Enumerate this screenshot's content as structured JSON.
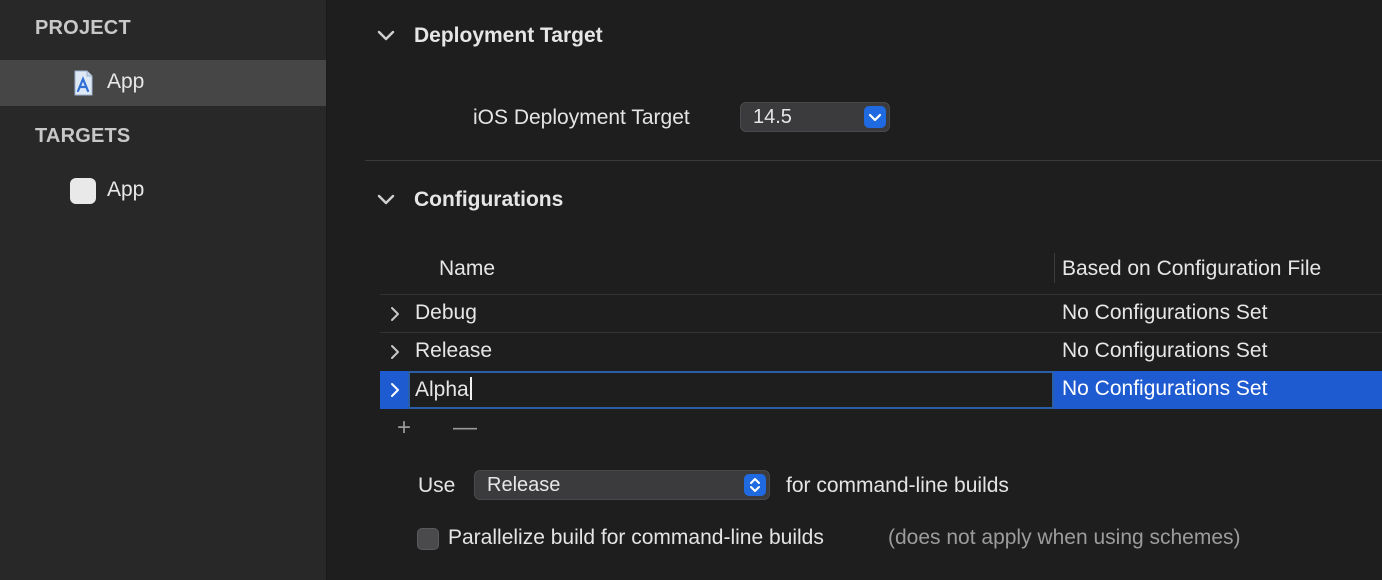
{
  "sidebar": {
    "project_header": "PROJECT",
    "project_items": [
      {
        "label": "App",
        "icon": "project-file-icon"
      }
    ],
    "targets_header": "TARGETS",
    "target_items": [
      {
        "label": "App",
        "icon": "app-target-icon"
      }
    ]
  },
  "deployment": {
    "title": "Deployment Target",
    "ios_label": "iOS Deployment Target",
    "ios_value": "14.5"
  },
  "configurations": {
    "title": "Configurations",
    "columns": [
      "Name",
      "Based on Configuration File"
    ],
    "rows": [
      {
        "name": "Debug",
        "based_on": "No Configurations Set"
      },
      {
        "name": "Release",
        "based_on": "No Configurations Set"
      },
      {
        "name": "Alpha",
        "based_on": "No Configurations Set"
      }
    ],
    "add_symbol": "+",
    "remove_symbol": "—"
  },
  "command_line": {
    "use_label": "Use",
    "use_value": "Release",
    "suffix": "for command-line builds",
    "parallelize_label": "Parallelize build for command-line builds",
    "parallelize_note": "(does not apply when using schemes)",
    "parallelize_checked": false
  },
  "colors": {
    "accent": "#1e5bd0",
    "background": "#1e1e1e",
    "sidebar": "#282828"
  }
}
